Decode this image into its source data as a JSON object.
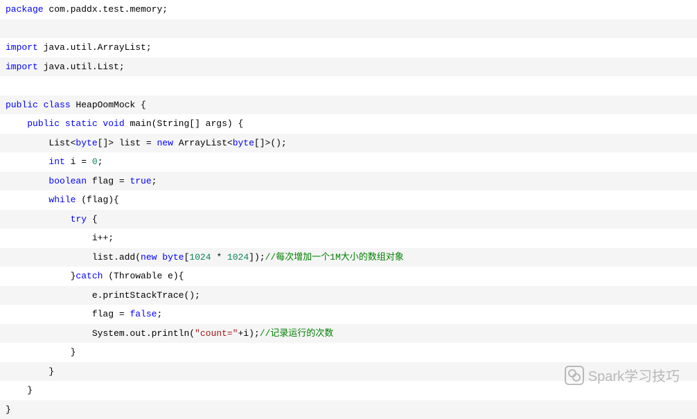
{
  "lines": [
    {
      "segments": [
        {
          "t": "package ",
          "c": "kw"
        },
        {
          "t": "com.paddx.test.memory;",
          "c": "pkg"
        }
      ]
    },
    {
      "segments": []
    },
    {
      "segments": [
        {
          "t": "import ",
          "c": "kw"
        },
        {
          "t": "java.util.ArrayList;",
          "c": "pkg"
        }
      ]
    },
    {
      "segments": [
        {
          "t": "import ",
          "c": "kw"
        },
        {
          "t": "java.util.List;",
          "c": "pkg"
        }
      ]
    },
    {
      "segments": []
    },
    {
      "segments": [
        {
          "t": "public class ",
          "c": "kw"
        },
        {
          "t": "HeapOomMock {",
          "c": "cls"
        }
      ]
    },
    {
      "segments": [
        {
          "t": "    ",
          "c": "plain"
        },
        {
          "t": "public static void ",
          "c": "kw"
        },
        {
          "t": "main(String[] args) {",
          "c": "method"
        }
      ]
    },
    {
      "segments": [
        {
          "t": "        List<",
          "c": "plain"
        },
        {
          "t": "byte",
          "c": "kw"
        },
        {
          "t": "[]> list = ",
          "c": "plain"
        },
        {
          "t": "new ",
          "c": "kw"
        },
        {
          "t": "ArrayList<",
          "c": "plain"
        },
        {
          "t": "byte",
          "c": "kw"
        },
        {
          "t": "[]>();",
          "c": "plain"
        }
      ]
    },
    {
      "segments": [
        {
          "t": "        ",
          "c": "plain"
        },
        {
          "t": "int ",
          "c": "kw"
        },
        {
          "t": "i = ",
          "c": "plain"
        },
        {
          "t": "0",
          "c": "num"
        },
        {
          "t": ";",
          "c": "plain"
        }
      ]
    },
    {
      "segments": [
        {
          "t": "        ",
          "c": "plain"
        },
        {
          "t": "boolean ",
          "c": "kw"
        },
        {
          "t": "flag = ",
          "c": "plain"
        },
        {
          "t": "true",
          "c": "bool"
        },
        {
          "t": ";",
          "c": "plain"
        }
      ]
    },
    {
      "segments": [
        {
          "t": "        ",
          "c": "plain"
        },
        {
          "t": "while ",
          "c": "kw"
        },
        {
          "t": "(flag){",
          "c": "plain"
        }
      ]
    },
    {
      "segments": [
        {
          "t": "            ",
          "c": "plain"
        },
        {
          "t": "try ",
          "c": "kw"
        },
        {
          "t": "{",
          "c": "plain"
        }
      ]
    },
    {
      "segments": [
        {
          "t": "                i++;",
          "c": "plain"
        }
      ]
    },
    {
      "segments": [
        {
          "t": "                list.add(",
          "c": "plain"
        },
        {
          "t": "new ",
          "c": "kw"
        },
        {
          "t": "byte",
          "c": "kw"
        },
        {
          "t": "[",
          "c": "plain"
        },
        {
          "t": "1024",
          "c": "num"
        },
        {
          "t": " * ",
          "c": "plain"
        },
        {
          "t": "1024",
          "c": "num"
        },
        {
          "t": "]);",
          "c": "plain"
        },
        {
          "t": "//每次增加一个1M大小的数组对象",
          "c": "comment"
        }
      ]
    },
    {
      "segments": [
        {
          "t": "            }",
          "c": "plain"
        },
        {
          "t": "catch ",
          "c": "kw"
        },
        {
          "t": "(Throwable e){",
          "c": "plain"
        }
      ]
    },
    {
      "segments": [
        {
          "t": "                e.printStackTrace();",
          "c": "plain"
        }
      ]
    },
    {
      "segments": [
        {
          "t": "                flag = ",
          "c": "plain"
        },
        {
          "t": "false",
          "c": "bool"
        },
        {
          "t": ";",
          "c": "plain"
        }
      ]
    },
    {
      "segments": [
        {
          "t": "                System.out.println(",
          "c": "plain"
        },
        {
          "t": "\"count=\"",
          "c": "str"
        },
        {
          "t": "+i);",
          "c": "plain"
        },
        {
          "t": "//记录运行的次数",
          "c": "comment"
        }
      ]
    },
    {
      "segments": [
        {
          "t": "            }",
          "c": "plain"
        }
      ]
    },
    {
      "segments": [
        {
          "t": "        }",
          "c": "plain"
        }
      ]
    },
    {
      "segments": [
        {
          "t": "    }",
          "c": "plain"
        }
      ]
    },
    {
      "segments": [
        {
          "t": "}",
          "c": "plain"
        }
      ]
    }
  ],
  "watermark": {
    "text": "Spark学习技巧"
  }
}
